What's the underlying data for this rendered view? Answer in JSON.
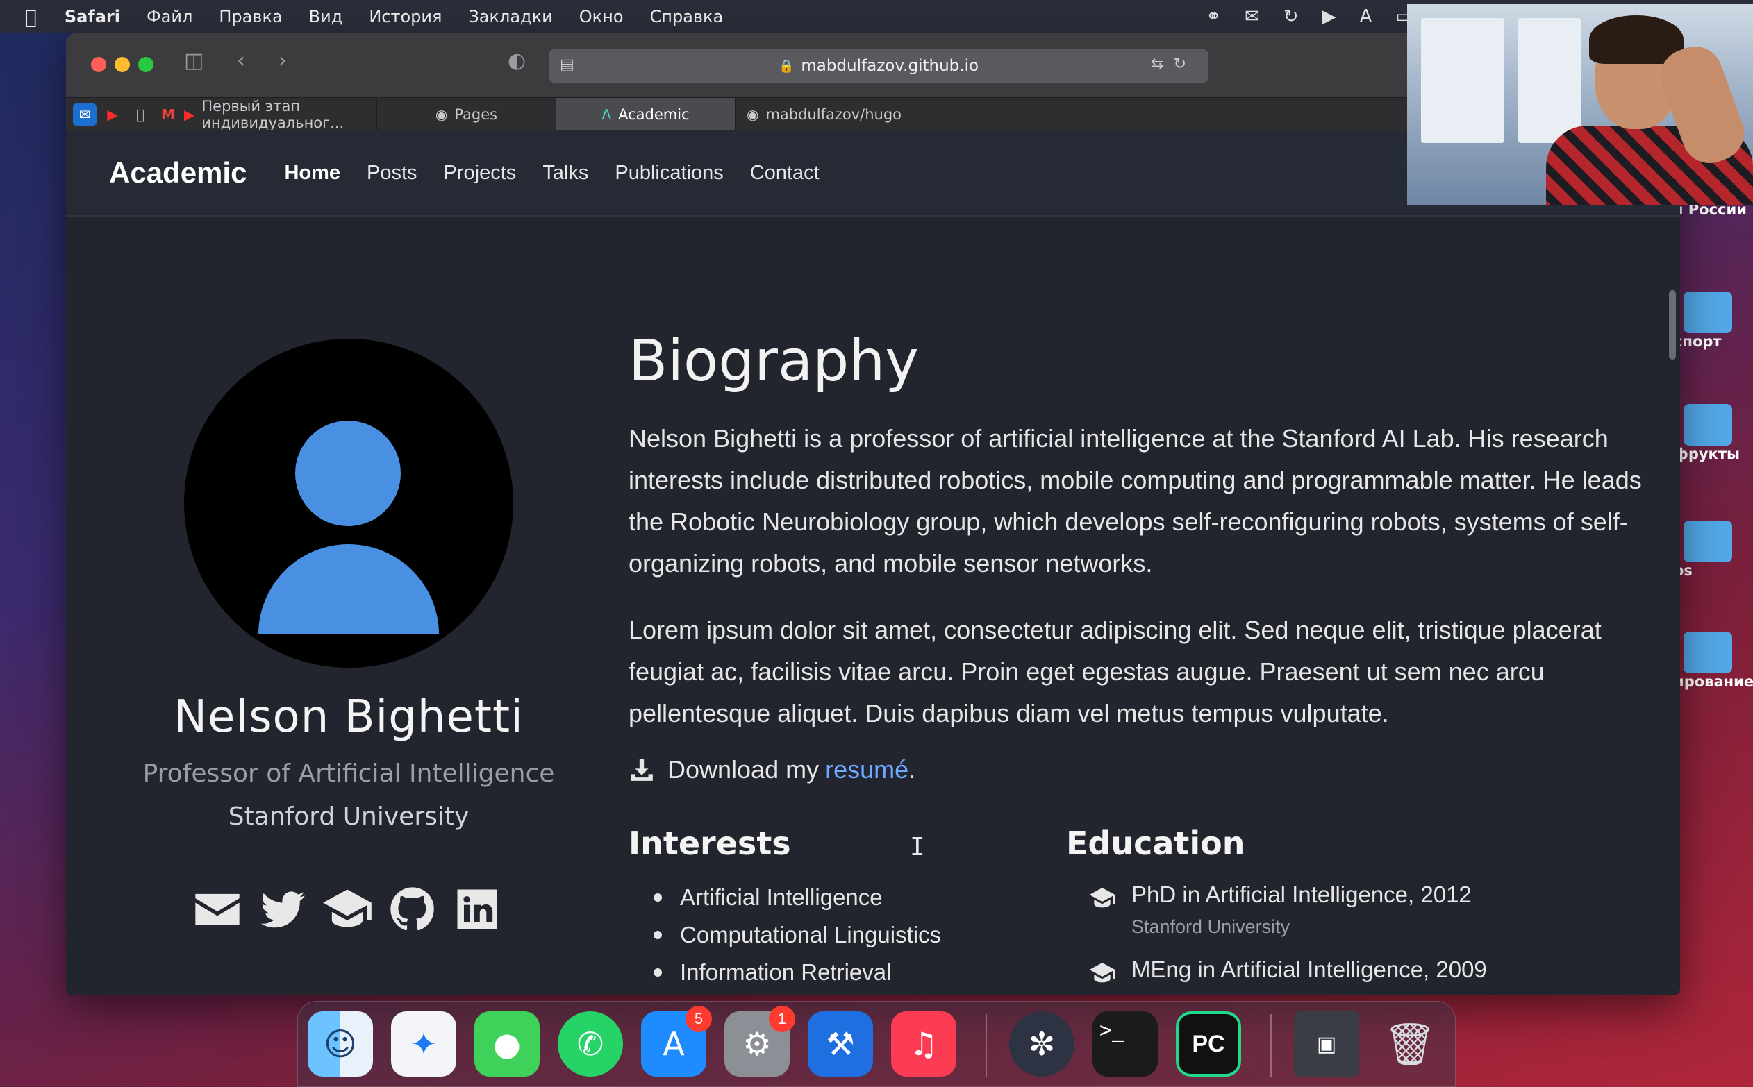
{
  "menubar": {
    "app_name": "Safari",
    "items": [
      "Файл",
      "Правка",
      "Вид",
      "История",
      "Закладки",
      "Окно",
      "Справка"
    ],
    "status_icons": [
      "creative-cloud-icon",
      "notification-icon",
      "sync-icon",
      "play-icon",
      "input-source-icon",
      "battery-icon"
    ],
    "input_source": "A"
  },
  "desktop": {
    "items": [
      "я России",
      "спорт",
      "фрукты",
      "os",
      "ирование"
    ]
  },
  "browser": {
    "url": "mabdulfazov.github.io",
    "tabs": [
      {
        "label": "Первый этап индивидуальног...",
        "icon": "youtube-icon"
      },
      {
        "label": "Pages",
        "icon": "github-icon"
      },
      {
        "label": "Academic",
        "icon": "academic-icon"
      },
      {
        "label": "mabdulfazov/hugo",
        "icon": "github-icon"
      }
    ],
    "pinned_tabs": [
      "mail-icon",
      "youtube-icon",
      "apple-icon",
      "gmail-icon"
    ]
  },
  "site": {
    "brand": "Academic",
    "nav": [
      "Home",
      "Posts",
      "Projects",
      "Talks",
      "Publications",
      "Contact"
    ],
    "active_nav": "Home",
    "profile": {
      "name": "Nelson Bighetti",
      "role": "Professor of Artificial Intelligence",
      "organization": "Stanford University",
      "social": [
        "envelope-icon",
        "twitter-icon",
        "graduation-cap-icon",
        "github-icon",
        "linkedin-icon"
      ]
    },
    "biography": {
      "title": "Biography",
      "paragraph1": "Nelson Bighetti is a professor of artificial intelligence at the Stanford AI Lab. His research interests include distributed robotics, mobile computing and programmable matter. He leads the Robotic Neurobiology group, which develops self-reconfiguring robots, systems of self-organizing robots, and mobile sensor networks.",
      "paragraph2": "Lorem ipsum dolor sit amet, consectetur adipiscing elit. Sed neque elit, tristique placerat feugiat ac, facilisis vitae arcu. Proin eget egestas augue. Praesent ut sem nec arcu pellentesque aliquet. Duis dapibus diam vel metus tempus vulputate.",
      "download_prefix": "Download my",
      "download_link": "resumé",
      "download_suffix": "."
    },
    "interests": {
      "title": "Interests",
      "items": [
        "Artificial Intelligence",
        "Computational Linguistics",
        "Information Retrieval"
      ]
    },
    "education": {
      "title": "Education",
      "items": [
        {
          "degree": "PhD in Artificial Intelligence, 2012",
          "school": "Stanford University"
        },
        {
          "degree": "MEng in Artificial Intelligence, 2009",
          "school": ""
        }
      ]
    }
  },
  "dock": {
    "apps": [
      {
        "name": "Finder",
        "icon": "finder-icon",
        "badge": ""
      },
      {
        "name": "Safari",
        "icon": "safari-icon",
        "badge": ""
      },
      {
        "name": "Messages",
        "icon": "messages-icon",
        "badge": ""
      },
      {
        "name": "WhatsApp",
        "icon": "whatsapp-icon",
        "badge": ""
      },
      {
        "name": "App Store",
        "icon": "app-store-icon",
        "badge": "5"
      },
      {
        "name": "System Preferences",
        "icon": "settings-icon",
        "badge": "1"
      },
      {
        "name": "Xcode",
        "icon": "xcode-icon",
        "badge": ""
      },
      {
        "name": "Music",
        "icon": "music-icon",
        "badge": ""
      },
      {
        "name": "OBS",
        "icon": "obs-icon",
        "badge": ""
      },
      {
        "name": "Terminal",
        "icon": "terminal-icon",
        "badge": ""
      },
      {
        "name": "PyCharm",
        "icon": "pycharm-icon",
        "badge": ""
      },
      {
        "name": "Recent",
        "icon": "recent-window-icon",
        "badge": ""
      },
      {
        "name": "Trash",
        "icon": "trash-icon",
        "badge": ""
      }
    ],
    "terminal_glyph": ">_",
    "pycharm_glyph": "PC"
  }
}
